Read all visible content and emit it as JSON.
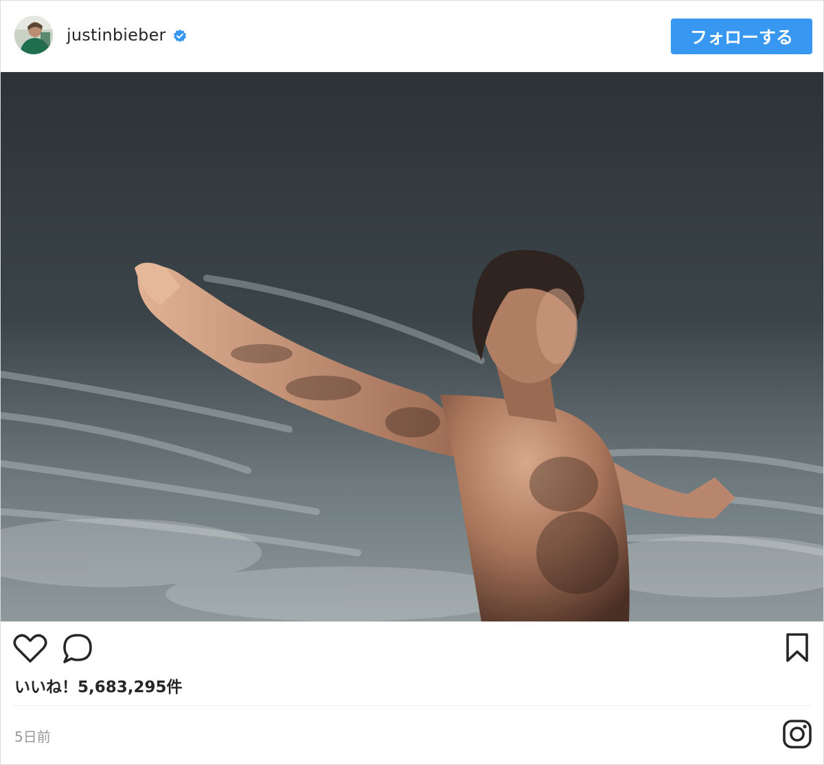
{
  "header": {
    "username": "justinbieber",
    "follow_label": "フォローする"
  },
  "post": {
    "likes_text": "いいね！5,683,295件",
    "timestamp": "5日前"
  },
  "icons": {
    "verified": "verified-badge-icon",
    "like": "heart-icon",
    "comment": "comment-icon",
    "save": "bookmark-icon",
    "platform": "instagram-icon"
  },
  "colors": {
    "accent": "#3897f0",
    "text": "#262626",
    "muted": "#999999"
  }
}
